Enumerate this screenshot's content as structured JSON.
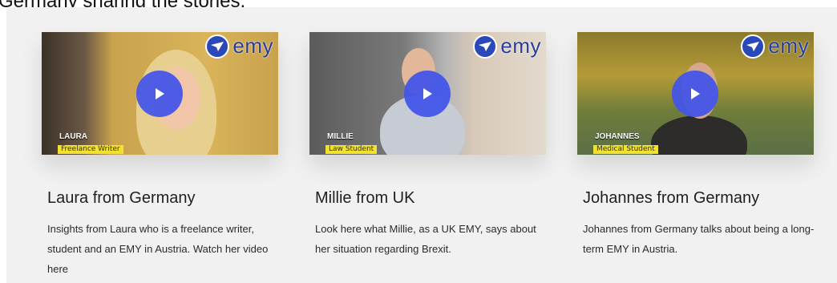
{
  "header": {
    "caption": "Germany sharing the stories."
  },
  "brand": {
    "logo_text": "emy",
    "accent": "#4254e9",
    "nameplate_yellow": "#f2e22e"
  },
  "cards": [
    {
      "title": "Laura from Germany",
      "description": "Insights from Laura who is a freelance writer, student and an EMY in Austria. Watch her video here",
      "nameplate_name": "LAURA",
      "nameplate_role": "Freelance Writer"
    },
    {
      "title": "Millie from UK",
      "description": "Look here what Millie, as a UK EMY, says about her situation regarding Brexit.",
      "nameplate_name": "MILLIE",
      "nameplate_role": "Law Student"
    },
    {
      "title": "Johannes from Germany",
      "description": "Johannes from Germany talks about being a long-term EMY in Austria.",
      "nameplate_name": "JOHANNES",
      "nameplate_role": "Medical Student"
    }
  ]
}
